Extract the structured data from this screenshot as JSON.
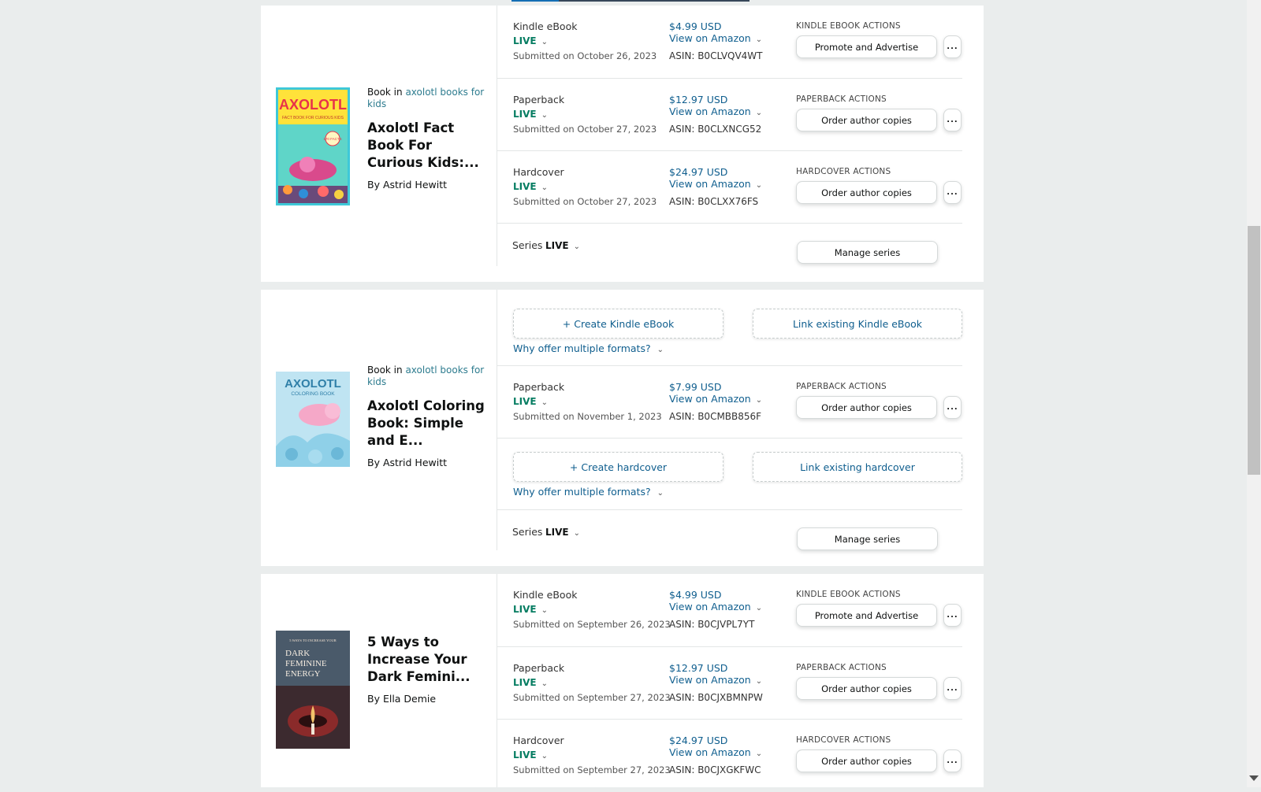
{
  "books": [
    {
      "series_prefix": "Book in",
      "series_name": "axolotl books for kids",
      "title": "Axolotl Fact Book For Curious Kids:...",
      "author": "By Astrid Hewitt",
      "cover": {
        "brand": "AXOLOTL",
        "subtitle": "FACT BOOK FOR CURIOUS KIDS",
        "badge": "170 FACTS",
        "colors": [
          "#3ec8d8",
          "#ffe23a",
          "#d94a8c"
        ]
      },
      "formats": [
        {
          "name": "Kindle eBook",
          "status": "LIVE",
          "submitted": "Submitted on October 26, 2023",
          "price": "$4.99 USD",
          "view": "View on Amazon",
          "asin": "ASIN: B0CLVQV4WT",
          "actions_title": "KINDLE EBOOK ACTIONS",
          "action_label": "Promote and Advertise",
          "more_label": "..."
        },
        {
          "name": "Paperback",
          "status": "LIVE",
          "submitted": "Submitted on October 27, 2023",
          "price": "$12.97 USD",
          "view": "View on Amazon",
          "asin": "ASIN: B0CLXNCG52",
          "actions_title": "PAPERBACK ACTIONS",
          "action_label": "Order author copies",
          "more_label": "..."
        },
        {
          "name": "Hardcover",
          "status": "LIVE",
          "submitted": "Submitted on October 27, 2023",
          "price": "$24.97 USD",
          "view": "View on Amazon",
          "asin": "ASIN: B0CLXX76FS",
          "actions_title": "HARDCOVER ACTIONS",
          "action_label": "Order author copies",
          "more_label": "..."
        }
      ],
      "series": {
        "label": "Series",
        "status": "LIVE",
        "button": "Manage series"
      }
    },
    {
      "series_prefix": "Book in",
      "series_name": "axolotl books for kids",
      "title": "Axolotl Coloring Book: Simple and E...",
      "author": "By Astrid Hewitt",
      "cover": {
        "brand": "AXOLOTL",
        "subtitle": "COLORING BOOK",
        "colors": [
          "#2f7fa8",
          "#f5a8c8",
          "#8fd0e8"
        ]
      },
      "create_kindle": {
        "create": "+ Create Kindle eBook",
        "link": "Link existing Kindle eBook",
        "why": "Why offer multiple formats?"
      },
      "formats": [
        {
          "name": "Paperback",
          "status": "LIVE",
          "submitted": "Submitted on November 1, 2023",
          "price": "$7.99 USD",
          "view": "View on Amazon",
          "asin": "ASIN: B0CMBB856F",
          "actions_title": "PAPERBACK ACTIONS",
          "action_label": "Order author copies",
          "more_label": "..."
        }
      ],
      "create_hardcover": {
        "create": "+ Create hardcover",
        "link": "Link existing hardcover",
        "why": "Why offer multiple formats?"
      },
      "series": {
        "label": "Series",
        "status": "LIVE",
        "button": "Manage series"
      }
    },
    {
      "title": "5 Ways to Increase Your Dark Femini...",
      "author": "By Ella Demie",
      "cover": {
        "top": "5 WAYS TO INCREASE YOUR",
        "line1": "DARK",
        "line2": "FEMININE",
        "line3": "ENERGY",
        "colors": [
          "#3c2a2f",
          "#8a2a2a",
          "#f3c26a"
        ]
      },
      "formats": [
        {
          "name": "Kindle eBook",
          "status": "LIVE",
          "submitted": "Submitted on September 26, 2023",
          "price": "$4.99 USD",
          "view": "View on Amazon",
          "asin": "ASIN: B0CJVPL7YT",
          "actions_title": "KINDLE EBOOK ACTIONS",
          "action_label": "Promote and Advertise",
          "more_label": "..."
        },
        {
          "name": "Paperback",
          "status": "LIVE",
          "submitted": "Submitted on September 27, 2023",
          "price": "$12.97 USD",
          "view": "View on Amazon",
          "asin": "ASIN: B0CJXBMNPW",
          "actions_title": "PAPERBACK ACTIONS",
          "action_label": "Order author copies",
          "more_label": "..."
        },
        {
          "name": "Hardcover",
          "status": "LIVE",
          "submitted": "Submitted on September 27, 2023",
          "price": "$24.97 USD",
          "view": "View on Amazon",
          "asin": "ASIN: B0CJXGKFWC",
          "actions_title": "HARDCOVER ACTIONS",
          "action_label": "Order author copies",
          "more_label": "..."
        }
      ]
    }
  ],
  "icons": {
    "dropdown": "chevron-down-icon",
    "more": "more-options-icon",
    "scroll": "scrollbar"
  }
}
